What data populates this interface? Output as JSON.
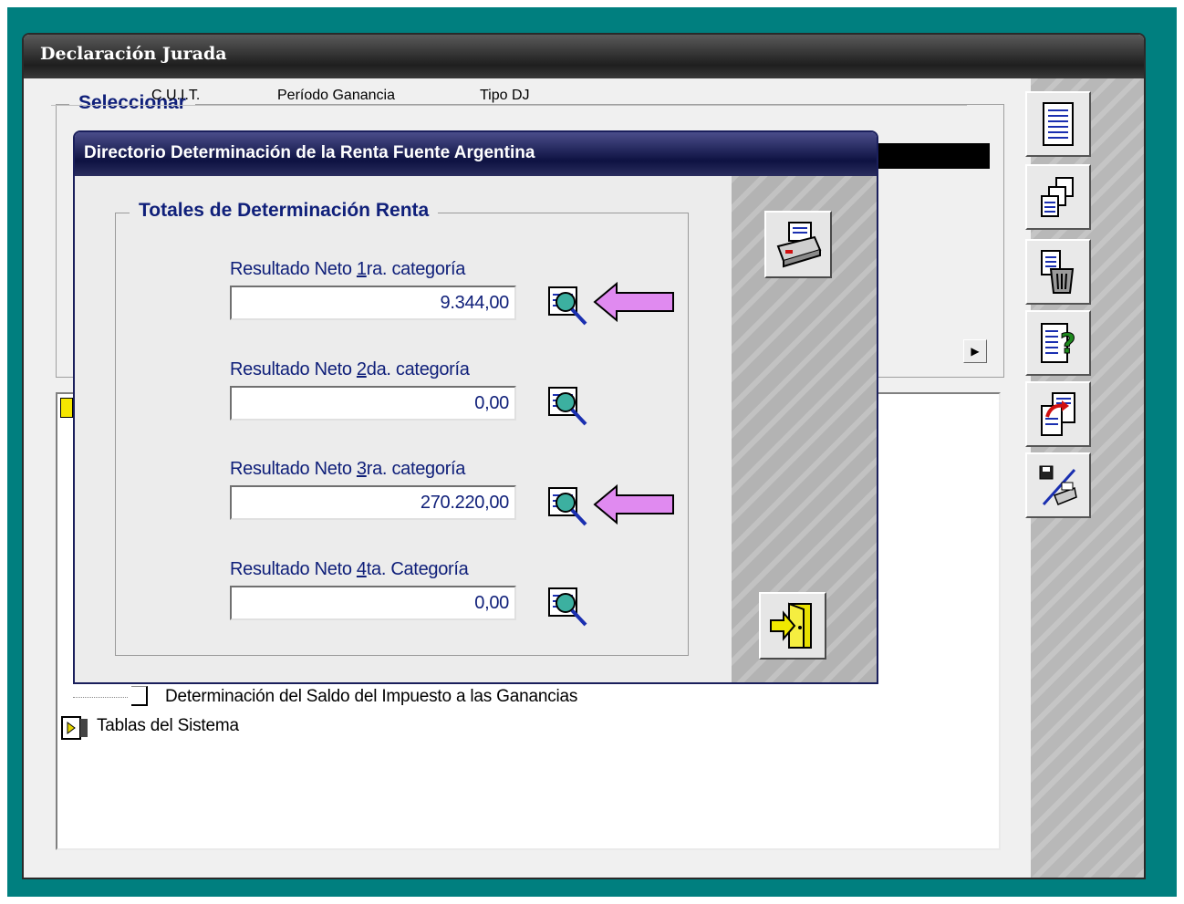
{
  "main_window": {
    "title": "Declaración Jurada",
    "select_group_label": "Seleccionar",
    "column_headers": [
      "C.U.I.T.",
      "Período Ganancia",
      "Tipo DJ"
    ],
    "tree": {
      "item_saldo": "Determinación del Saldo del Impuesto a las Ganancias",
      "item_tablas": "Tablas del Sistema"
    },
    "toolbar": [
      {
        "icon": "document-list-icon"
      },
      {
        "icon": "copy-documents-icon"
      },
      {
        "icon": "trash-document-icon"
      },
      {
        "icon": "help-document-icon"
      },
      {
        "icon": "export-document-icon"
      },
      {
        "icon": "disk-printer-icon"
      }
    ]
  },
  "dialog": {
    "title": "Directorio Determinación de la Renta Fuente Argentina",
    "group_label": "Totales de Determinación Renta",
    "fields": [
      {
        "label_pre": "Resultado Neto ",
        "label_key": "1",
        "label_post": "ra. categoría",
        "value": "9.344,00",
        "highlighted": true
      },
      {
        "label_pre": "Resultado Neto ",
        "label_key": "2",
        "label_post": "da. categoría",
        "value": "0,00",
        "highlighted": false
      },
      {
        "label_pre": "Resultado Neto ",
        "label_key": "3",
        "label_post": "ra. categoría",
        "value": "270.220,00",
        "highlighted": true
      },
      {
        "label_pre": "Resultado Neto ",
        "label_key": "4",
        "label_post": "ta. Categoría",
        "value": "0,00",
        "highlighted": false
      }
    ],
    "print_icon": "printer-icon",
    "exit_icon": "exit-door-icon"
  },
  "colors": {
    "teal_frame": "#007f7f",
    "label_blue": "#10207a",
    "annotation_arrow": "#e08af0"
  }
}
